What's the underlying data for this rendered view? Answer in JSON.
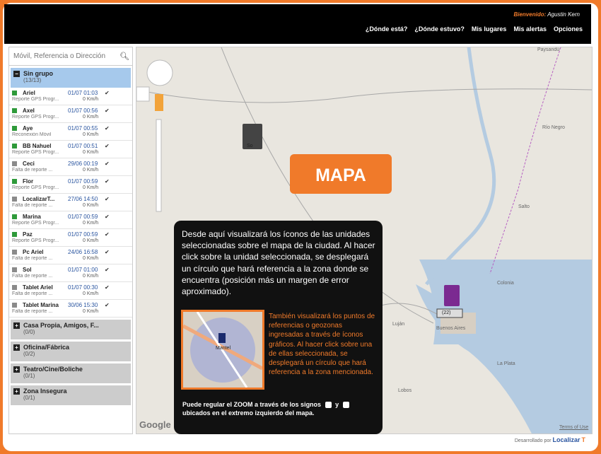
{
  "header": {
    "welcome_label": "Bienvenido:",
    "user_name": "Agustin Kern",
    "nav": [
      "¿Dónde está?",
      "¿Dónde estuvo?",
      "Mis lugares",
      "Mis alertas",
      "Opciones"
    ]
  },
  "search": {
    "placeholder": "Móvil, Referencia o Dirección"
  },
  "groups": {
    "active": {
      "title": "Sin grupo",
      "count": "(13/13)"
    },
    "others": [
      {
        "title": "Casa Propia, Amigos, F...",
        "count": "(0/0)"
      },
      {
        "title": "Oficina/Fábrica",
        "count": "(0/2)"
      },
      {
        "title": "Teatro/Cine/Boliche",
        "count": "(0/1)"
      },
      {
        "title": "Zona Insegura",
        "count": "(0/1)"
      }
    ]
  },
  "units": [
    {
      "name": "Ariel",
      "date": "01/07 01:03",
      "desc": "Reporte GPS Progr...",
      "speed": "0 Km/h",
      "status": "green"
    },
    {
      "name": "Axel",
      "date": "01/07 00:56",
      "desc": "Reporte GPS Progr...",
      "speed": "0 Km/h",
      "status": "green"
    },
    {
      "name": "Aye",
      "date": "01/07 00:55",
      "desc": "Reconexión Móvil",
      "speed": "0 Km/h",
      "status": "green"
    },
    {
      "name": "BB Nahuel",
      "date": "01/07 00:51",
      "desc": "Reporte GPS Progr...",
      "speed": "0 Km/h",
      "status": "green"
    },
    {
      "name": "Ceci",
      "date": "29/06 00:19",
      "desc": "Falta de reporte ...",
      "speed": "0 Km/h",
      "status": "gray"
    },
    {
      "name": "Flor",
      "date": "01/07 00:59",
      "desc": "Reporte GPS Progr...",
      "speed": "0 Km/h",
      "status": "green"
    },
    {
      "name": "LocalizarT...",
      "date": "27/06 14:50",
      "desc": "Falta de reporte ...",
      "speed": "0 Km/h",
      "status": "gray"
    },
    {
      "name": "Marina",
      "date": "01/07 00:59",
      "desc": "Reporte GPS Progr...",
      "speed": "0 Km/h",
      "status": "green"
    },
    {
      "name": "Paz",
      "date": "01/07 00:59",
      "desc": "Reporte GPS Progr...",
      "speed": "0 Km/h",
      "status": "green"
    },
    {
      "name": "Pc Ariel",
      "date": "24/06 16:58",
      "desc": "Falta de reporte ...",
      "speed": "0 Km/h",
      "status": "gray"
    },
    {
      "name": "Sol",
      "date": "01/07 01:00",
      "desc": "Falta de reporte ...",
      "speed": "0 Km/h",
      "status": "gray"
    },
    {
      "name": "Tablet Ariel",
      "date": "01/07 00:30",
      "desc": "Falta de reporte ...",
      "speed": "0 Km/h",
      "status": "gray"
    },
    {
      "name": "Tablet Marina",
      "date": "30/06 15:30",
      "desc": "Falta de reporte ...",
      "speed": "0 Km/h",
      "status": "gray"
    }
  ],
  "callout": {
    "badge": "MAPA",
    "main_text": "Desde aquí visualizará  los íconos de las unidades seleccionadas sobre el mapa de la ciudad. Al hacer click sobre la unidad seleccionada, se desplegará un círculo que hará referencia a la zona donde se encuentra (posición más un margen de error aproximado).",
    "orange_text": "También visualizará los puntos de referencias o geozonas ingresadas a través de íconos gráficos. Al hacer click sobre una de ellas seleccionada, se desplegará un círculo que hará referencia a la zona mencionada.",
    "zoom_text_a": "Puede regular el ZOOM a través de los signos",
    "zoom_text_y": "y",
    "zoom_text_b": "ubicados en el extremo  izquierdo del mapa.",
    "thumb_label": "Mantel"
  },
  "map": {
    "labels": {
      "rio_negro": "Río Negro",
      "salto": "Salto",
      "colonia": "Colonia",
      "buenos_aires": "Buenos Aires",
      "la_plata": "La Plata",
      "lobos": "Lobos",
      "lujan": "Luján",
      "flag_count": "(22)",
      "unit_label": "So",
      "terms": "Terms of Use",
      "google": "Google",
      "paysandu": "Paysandú"
    }
  },
  "footer": {
    "dev_label": "Desarrollado por",
    "brand": "Localizar",
    "brand_t": "T"
  },
  "colors": {
    "accent": "#f07a2a",
    "group_active": "#a6c9ec",
    "status_green": "#2e9a3a",
    "status_gray": "#8a8a8a"
  }
}
